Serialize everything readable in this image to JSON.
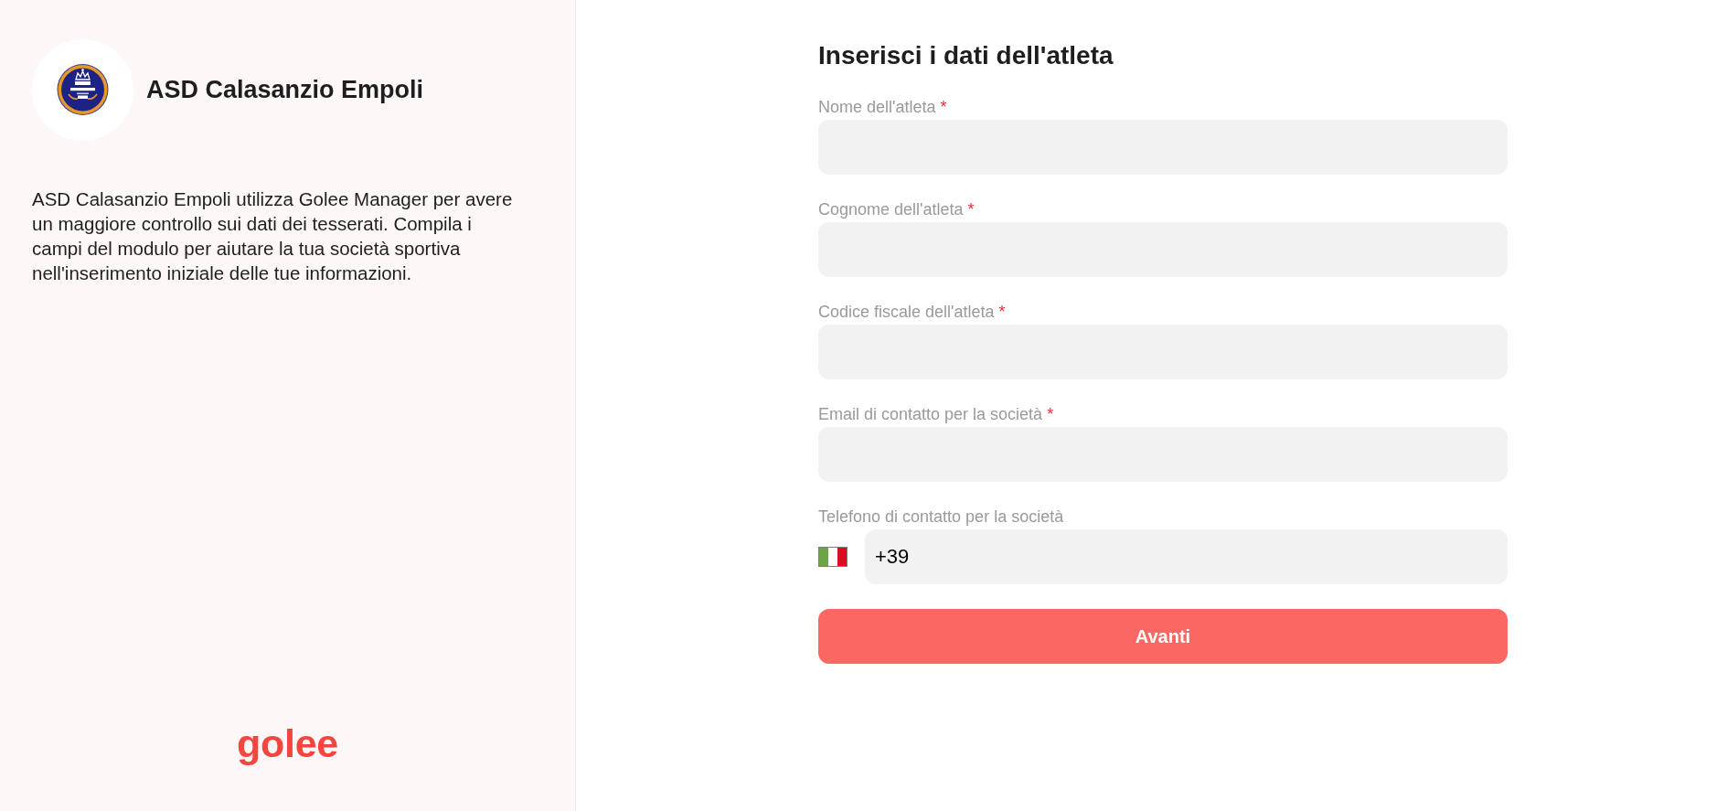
{
  "club": {
    "name": "ASD Calasanzio Empoli",
    "description": "ASD Calasanzio Empoli utilizza Golee Manager per avere un maggiore controllo sui dati dei tesserati. Compila i campi del modulo per aiutare la tua società sportiva nell'inserimento iniziale delle tue informazioni."
  },
  "brand": {
    "logo_text": "golee"
  },
  "form": {
    "title": "Inserisci i dati dell'atleta",
    "required_mark": "*",
    "fields": [
      {
        "kind": "text",
        "label": "Nome dell'atleta",
        "required": true
      },
      {
        "kind": "text",
        "label": "Cognome dell'atleta",
        "required": true
      },
      {
        "kind": "text",
        "label": "Codice fiscale dell'atleta",
        "required": true
      },
      {
        "kind": "text",
        "label": "Email di contatto per la società",
        "required": true
      },
      {
        "kind": "phone",
        "label": "Telefono di contatto per la società",
        "required": false,
        "value": "+39"
      }
    ],
    "submit_button": "Avanti"
  }
}
